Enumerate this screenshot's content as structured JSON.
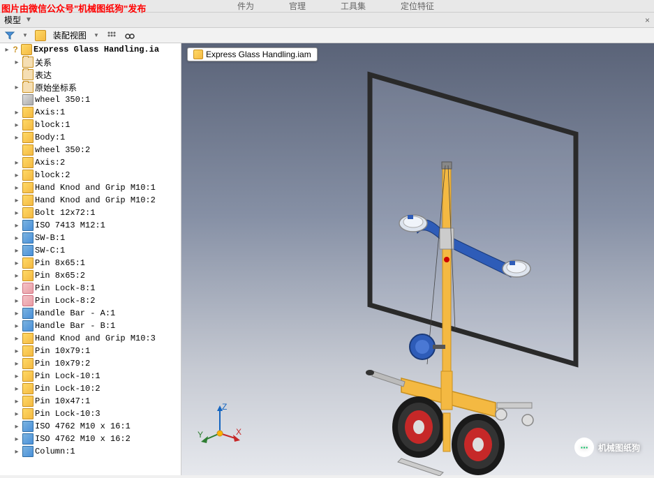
{
  "watermark_top": "图片由微信公众号\"机械图纸狗\"发布",
  "watermark_bottom": "机械图纸狗",
  "menu": [
    "件为",
    "官理",
    "工具集",
    "定位特征"
  ],
  "panel": {
    "title": "模型",
    "dropdown": "▼",
    "close": "×"
  },
  "toolbar": {
    "assembly_view": "装配视图",
    "filter": "filter-icon",
    "grip": "grip-icon",
    "binoculars": "binoculars-icon"
  },
  "viewport_tab": "Express Glass Handling.iam",
  "triad": {
    "x": "X",
    "y": "Y",
    "z": "Z"
  },
  "tree": [
    {
      "exp": "▸",
      "icon": "asm",
      "q": "?",
      "label": "Express Glass Handling.ia",
      "bold": true
    },
    {
      "exp": "▸",
      "icon": "fold",
      "label": "关系",
      "indent": 1
    },
    {
      "exp": "",
      "icon": "fold",
      "label": "表达",
      "indent": 1
    },
    {
      "exp": "▸",
      "icon": "fold",
      "label": "原始坐标系",
      "indent": 1
    },
    {
      "exp": "",
      "icon": "grey",
      "label": "wheel 350:1",
      "indent": 1
    },
    {
      "exp": "▸",
      "icon": "part",
      "label": "Axis:1",
      "indent": 1
    },
    {
      "exp": "▸",
      "icon": "part",
      "label": "block:1",
      "indent": 1
    },
    {
      "exp": "▸",
      "icon": "part",
      "label": "Body:1",
      "indent": 1
    },
    {
      "exp": "",
      "icon": "part",
      "label": "wheel 350:2",
      "indent": 1
    },
    {
      "exp": "▸",
      "icon": "part",
      "label": "Axis:2",
      "indent": 1
    },
    {
      "exp": "▸",
      "icon": "part",
      "label": "block:2",
      "indent": 1
    },
    {
      "exp": "▸",
      "icon": "part",
      "label": "Hand Knod and Grip M10:1",
      "indent": 1
    },
    {
      "exp": "▸",
      "icon": "part",
      "label": "Hand Knod and Grip M10:2",
      "indent": 1
    },
    {
      "exp": "▸",
      "icon": "part",
      "label": "Bolt 12x72:1",
      "indent": 1
    },
    {
      "exp": "▸",
      "icon": "blue",
      "label": "ISO 7413 M12:1",
      "indent": 1
    },
    {
      "exp": "▸",
      "icon": "blue",
      "label": "SW-B:1",
      "indent": 1
    },
    {
      "exp": "▸",
      "icon": "blue",
      "label": "SW-C:1",
      "indent": 1
    },
    {
      "exp": "▸",
      "icon": "part",
      "label": "Pin 8x65:1",
      "indent": 1
    },
    {
      "exp": "▸",
      "icon": "part",
      "label": "Pin 8x65:2",
      "indent": 1
    },
    {
      "exp": "▸",
      "icon": "pink",
      "label": "Pin Lock-8:1",
      "indent": 1
    },
    {
      "exp": "▸",
      "icon": "pink",
      "label": "Pin Lock-8:2",
      "indent": 1
    },
    {
      "exp": "▸",
      "icon": "blue",
      "label": "Handle Bar - A:1",
      "indent": 1
    },
    {
      "exp": "▸",
      "icon": "blue",
      "label": "Handle Bar - B:1",
      "indent": 1
    },
    {
      "exp": "▸",
      "icon": "part",
      "label": "Hand Knod and Grip M10:3",
      "indent": 1
    },
    {
      "exp": "▸",
      "icon": "part",
      "label": "Pin 10x79:1",
      "indent": 1
    },
    {
      "exp": "▸",
      "icon": "part",
      "label": "Pin 10x79:2",
      "indent": 1
    },
    {
      "exp": "▸",
      "icon": "part",
      "label": "Pin Lock-10:1",
      "indent": 1
    },
    {
      "exp": "▸",
      "icon": "part",
      "label": "Pin Lock-10:2",
      "indent": 1
    },
    {
      "exp": "▸",
      "icon": "part",
      "label": "Pin 10x47:1",
      "indent": 1
    },
    {
      "exp": "▸",
      "icon": "part",
      "label": "Pin Lock-10:3",
      "indent": 1
    },
    {
      "exp": "▸",
      "icon": "blue",
      "label": "ISO 4762 M10 x 16:1",
      "indent": 1
    },
    {
      "exp": "▸",
      "icon": "blue",
      "label": "ISO 4762 M10 x 16:2",
      "indent": 1
    },
    {
      "exp": "▸",
      "icon": "blue",
      "label": "Column:1",
      "indent": 1
    }
  ]
}
